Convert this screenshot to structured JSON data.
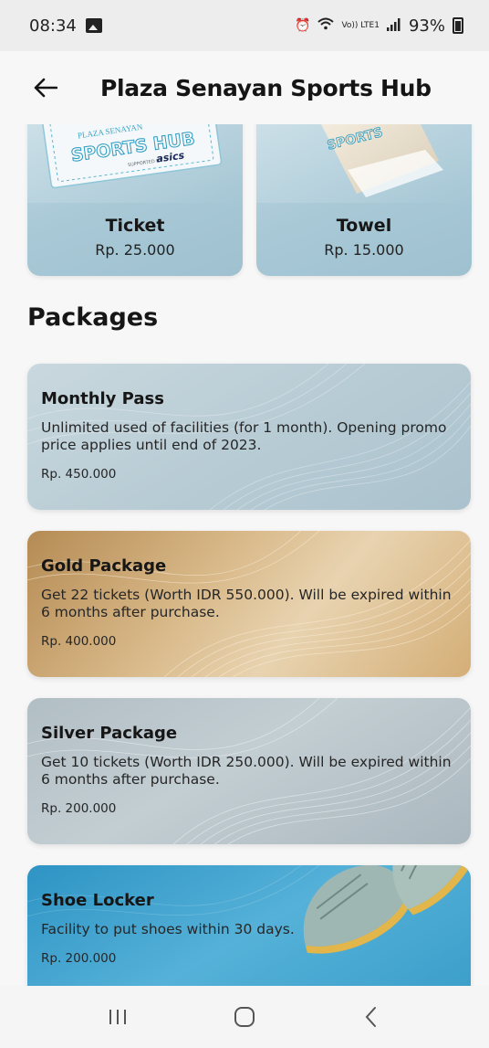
{
  "status_bar": {
    "time": "08:34",
    "battery": "93%",
    "network_text": "Vo)) LTE1"
  },
  "header": {
    "title": "Plaza Senayan Sports Hub"
  },
  "products": [
    {
      "name": "Ticket",
      "price": "Rp. 25.000",
      "image_text_top": "PLAZA SENAYAN",
      "image_text_main": "SPORTS HUB",
      "image_text_sub": "SUPPORTED BY",
      "image_brand": "asics"
    },
    {
      "name": "Towel",
      "price": "Rp. 15.000",
      "image_text_main": "SPORTS"
    }
  ],
  "packages_section": {
    "title": "Packages",
    "items": [
      {
        "name": "Monthly Pass",
        "description": "Unlimited used of facilities (for 1 month). Opening promo price applies until end of 2023.",
        "price": "Rp. 450.000"
      },
      {
        "name": "Gold Package",
        "description": "Get 22 tickets (Worth IDR 550.000). Will be expired within 6 months after purchase.",
        "price": "Rp. 400.000"
      },
      {
        "name": "Silver Package",
        "description": "Get 10 tickets (Worth IDR 250.000). Will be expired within 6 months after purchase.",
        "price": "Rp. 200.000"
      },
      {
        "name": "Shoe Locker",
        "description": "Facility to put shoes within 30 days.",
        "price": "Rp. 200.000"
      }
    ]
  },
  "nav_bar": {
    "icons": [
      "recent-apps-icon",
      "home-icon",
      "back-icon"
    ]
  },
  "colors": {
    "product_card": "#a8c8d6",
    "monthly": "#b7cbd4",
    "gold": "#d8b888",
    "silver": "#c3ced3",
    "shoe_locker": "#55b1d8"
  }
}
